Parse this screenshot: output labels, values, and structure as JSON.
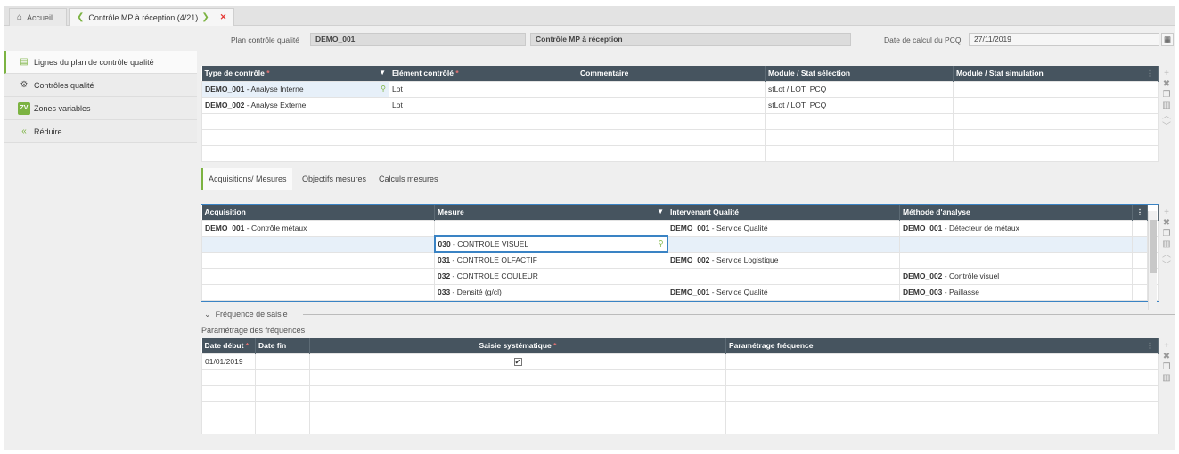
{
  "tabs": {
    "home": "Accueil",
    "active": "Contrôle MP à réception",
    "active_counter": "(4/21)"
  },
  "header": {
    "plan_label": "Plan contrôle qualité",
    "plan_code": "DEMO_001",
    "plan_name": "Contrôle MP à réception",
    "date_label": "Date de calcul du PCQ",
    "date_value": "27/11/2019"
  },
  "sidebar": [
    {
      "label": "Lignes du plan de contrôle qualité"
    },
    {
      "label": "Contrôles qualité"
    },
    {
      "label": "Zones variables",
      "badge": "ZV"
    },
    {
      "label": "Réduire"
    }
  ],
  "grid1": {
    "columns": [
      "Type de contrôle",
      "Elément contrôlé",
      "Commentaire",
      "Module / Stat sélection",
      "Module / Stat simulation"
    ],
    "rows": [
      {
        "code": "DEMO_001",
        "text": " - Analyse Interne",
        "element": "Lot",
        "comment": "",
        "stat_sel": "stLot / LOT_PCQ",
        "stat_sim": ""
      },
      {
        "code": "DEMO_002",
        "text": " - Analyse Externe",
        "element": "Lot",
        "comment": "",
        "stat_sel": "stLot / LOT_PCQ",
        "stat_sim": ""
      }
    ]
  },
  "subtabs": [
    "Acquisitions/ Mesures",
    "Objectifs mesures",
    "Calculs mesures"
  ],
  "grid2": {
    "columns": [
      "Acquisition",
      "Mesure",
      "Intervenant Qualité",
      "Méthode d'analyse"
    ],
    "rows": [
      {
        "acq_code": "DEMO_001",
        "acq_text": " - Contrôle métaux",
        "m_code": "",
        "m_text": "",
        "int_code": "DEMO_001",
        "int_text": " - Service Qualité",
        "meth_code": "DEMO_001",
        "meth_text": " - Détecteur de métaux"
      },
      {
        "acq_code": "",
        "acq_text": "",
        "m_code": "030",
        "m_text": " - CONTROLE VISUEL",
        "int_code": "",
        "int_text": "",
        "meth_code": "",
        "meth_text": ""
      },
      {
        "acq_code": "",
        "acq_text": "",
        "m_code": "031",
        "m_text": " - CONTROLE OLFACTIF",
        "int_code": "DEMO_002",
        "int_text": " - Service Logistique",
        "meth_code": "",
        "meth_text": ""
      },
      {
        "acq_code": "",
        "acq_text": "",
        "m_code": "032",
        "m_text": " - CONTROLE COULEUR",
        "int_code": "",
        "int_text": "",
        "meth_code": "DEMO_002",
        "meth_text": " - Contrôle visuel"
      },
      {
        "acq_code": "",
        "acq_text": "",
        "m_code": "033",
        "m_text": " - Densité (g/cl)",
        "int_code": "DEMO_001",
        "int_text": " - Service Qualité",
        "meth_code": "DEMO_003",
        "meth_text": " - Paillasse"
      }
    ]
  },
  "freq_section": {
    "title": "Fréquence de saisie",
    "subtitle": "Paramétrage des fréquences"
  },
  "grid3": {
    "columns": [
      "Date début",
      "Date fin",
      "Saisie systématique",
      "Paramétrage fréquence"
    ],
    "rows": [
      {
        "start": "01/01/2019",
        "end": "",
        "checked": true,
        "param": ""
      }
    ]
  },
  "colors": {
    "header_bg": "#46545f",
    "accent": "#7cb342",
    "close": "#e53935",
    "focus": "#3a83c4"
  }
}
